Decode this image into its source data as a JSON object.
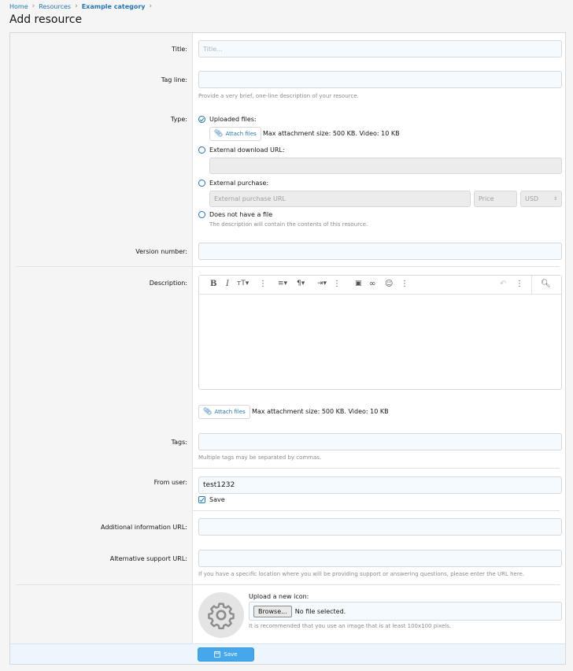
{
  "breadcrumb": {
    "items": [
      "Home",
      "Resources",
      "Example category"
    ]
  },
  "page": {
    "title": "Add resource"
  },
  "fields": {
    "title": {
      "label": "Title:",
      "placeholder": "Title..."
    },
    "tagline": {
      "label": "Tag line:",
      "hint": "Provide a very brief, one-line description of your resource."
    },
    "type": {
      "label": "Type:",
      "options": {
        "uploaded": "Uploaded files:",
        "external_url": "External download URL:",
        "external_purchase": "External purchase:",
        "no_file": "Does not have a file"
      },
      "selected": "uploaded",
      "attach_label": "Attach files",
      "attach_info": "Max attachment size: 500 KB. Video: 10 KB",
      "purchase_url_placeholder": "External purchase URL",
      "price_placeholder": "Price",
      "currency": "USD",
      "no_file_hint": "The description will contain the contents of this resource."
    },
    "version": {
      "label": "Version number:"
    },
    "description": {
      "label": "Description:",
      "toolbar": [
        "bold-icon",
        "italic-icon",
        "font-size-icon",
        "more-icon",
        "align-icon",
        "paragraph-icon",
        "indent-icon",
        "more-icon",
        "image-icon",
        "link-icon",
        "smile-icon",
        "more-icon",
        "undo-icon",
        "more-icon",
        "preview-icon"
      ],
      "attach_label": "Attach files",
      "attach_info": "Max attachment size: 500 KB. Video: 10 KB"
    },
    "tags": {
      "label": "Tags:",
      "hint": "Multiple tags may be separated by commas."
    },
    "from_user": {
      "label": "From user:",
      "value": "test1232",
      "save_label": "Save"
    },
    "additional_url": {
      "label": "Additional information URL:"
    },
    "support_url": {
      "label": "Alternative support URL:",
      "hint": "If you have a specific location where you will be providing support or answering questions, please enter the URL here."
    },
    "icon": {
      "upload_label": "Upload a new icon:",
      "browse_label": "Browse...",
      "file_status": "No file selected.",
      "hint": "It is recommended that you use an image that is at least 100x100 pixels."
    }
  },
  "footer": {
    "save_label": "Save"
  },
  "colors": {
    "accent": "#2577b1",
    "button": "#47a7eb",
    "footer": "#edf6fd"
  }
}
